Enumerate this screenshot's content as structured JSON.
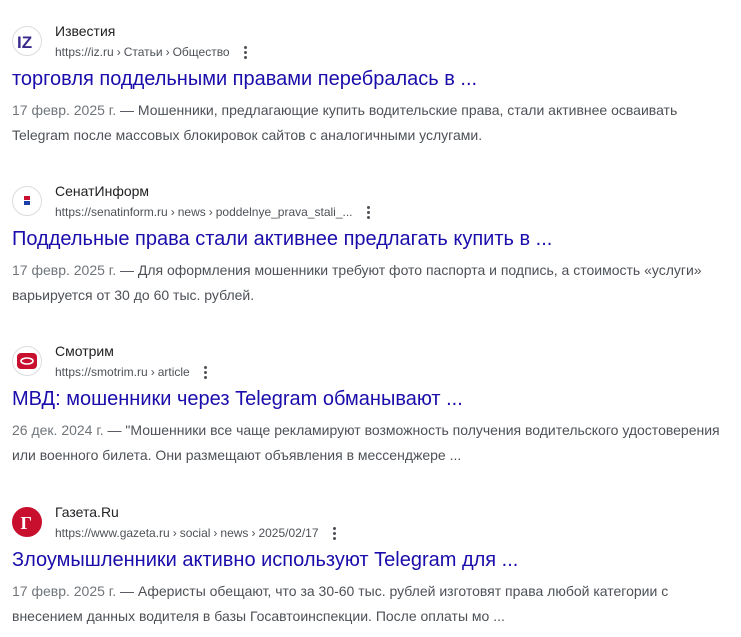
{
  "results": [
    {
      "site": "Известия",
      "crumbs": [
        "https://iz.ru",
        "Статьи",
        "Общество"
      ],
      "title": "торговля поддельными правами перебралась в ...",
      "date": "17 февр. 2025 г.",
      "snippet": " — Мошенники, предлагающие купить водительские права, стали активнее осваивать Telegram после массовых блокировок сайтов с аналогичными услугами.",
      "favicon": "iz-logo-icon",
      "favicon_color": "#3b2a8c"
    },
    {
      "site": "СенатИнформ",
      "crumbs": [
        "https://senatinform.ru",
        "news",
        "poddelnye_prava_stali_..."
      ],
      "title": "Поддельные права стали активнее предлагать купить в ...",
      "date": "17 февр. 2025 г.",
      "snippet": " — Для оформления мошенники требуют фото паспорта и подпись, а стоимость «услуги» варьируется от 30 до 60 тыс. рублей.",
      "favicon": "senatinform-logo-icon",
      "favicon_color": "#1f3fa8"
    },
    {
      "site": "Смотрим",
      "crumbs": [
        "https://smotrim.ru",
        "article"
      ],
      "title": "МВД: мошенники через Telegram обманывают ...",
      "date": "26 дек. 2024 г.",
      "snippet": " — \"Мошенники все чаще рекламируют возможность получения водительского удостоверения или военного билета. Они размещают объявления в мессенджере ...",
      "favicon": "smotrim-logo-icon",
      "favicon_color": "#c8102e"
    },
    {
      "site": "Газета.Ru",
      "crumbs": [
        "https://www.gazeta.ru",
        "social",
        "news",
        "2025/02/17"
      ],
      "title": "Злоумышленники активно используют Telegram для ...",
      "date": "17 февр. 2025 г.",
      "snippet": " — Аферисты обещают, что за 30-60 тыс. рублей изготовят права любой категории с внесением данных водителя в базы Госавтоинспекции. После оплаты мо ...",
      "favicon": "gazeta-logo-icon",
      "favicon_color": "#c8102e"
    }
  ],
  "colors": {
    "link": "#1a0dab",
    "text": "#4d5156",
    "date": "#70757a"
  }
}
